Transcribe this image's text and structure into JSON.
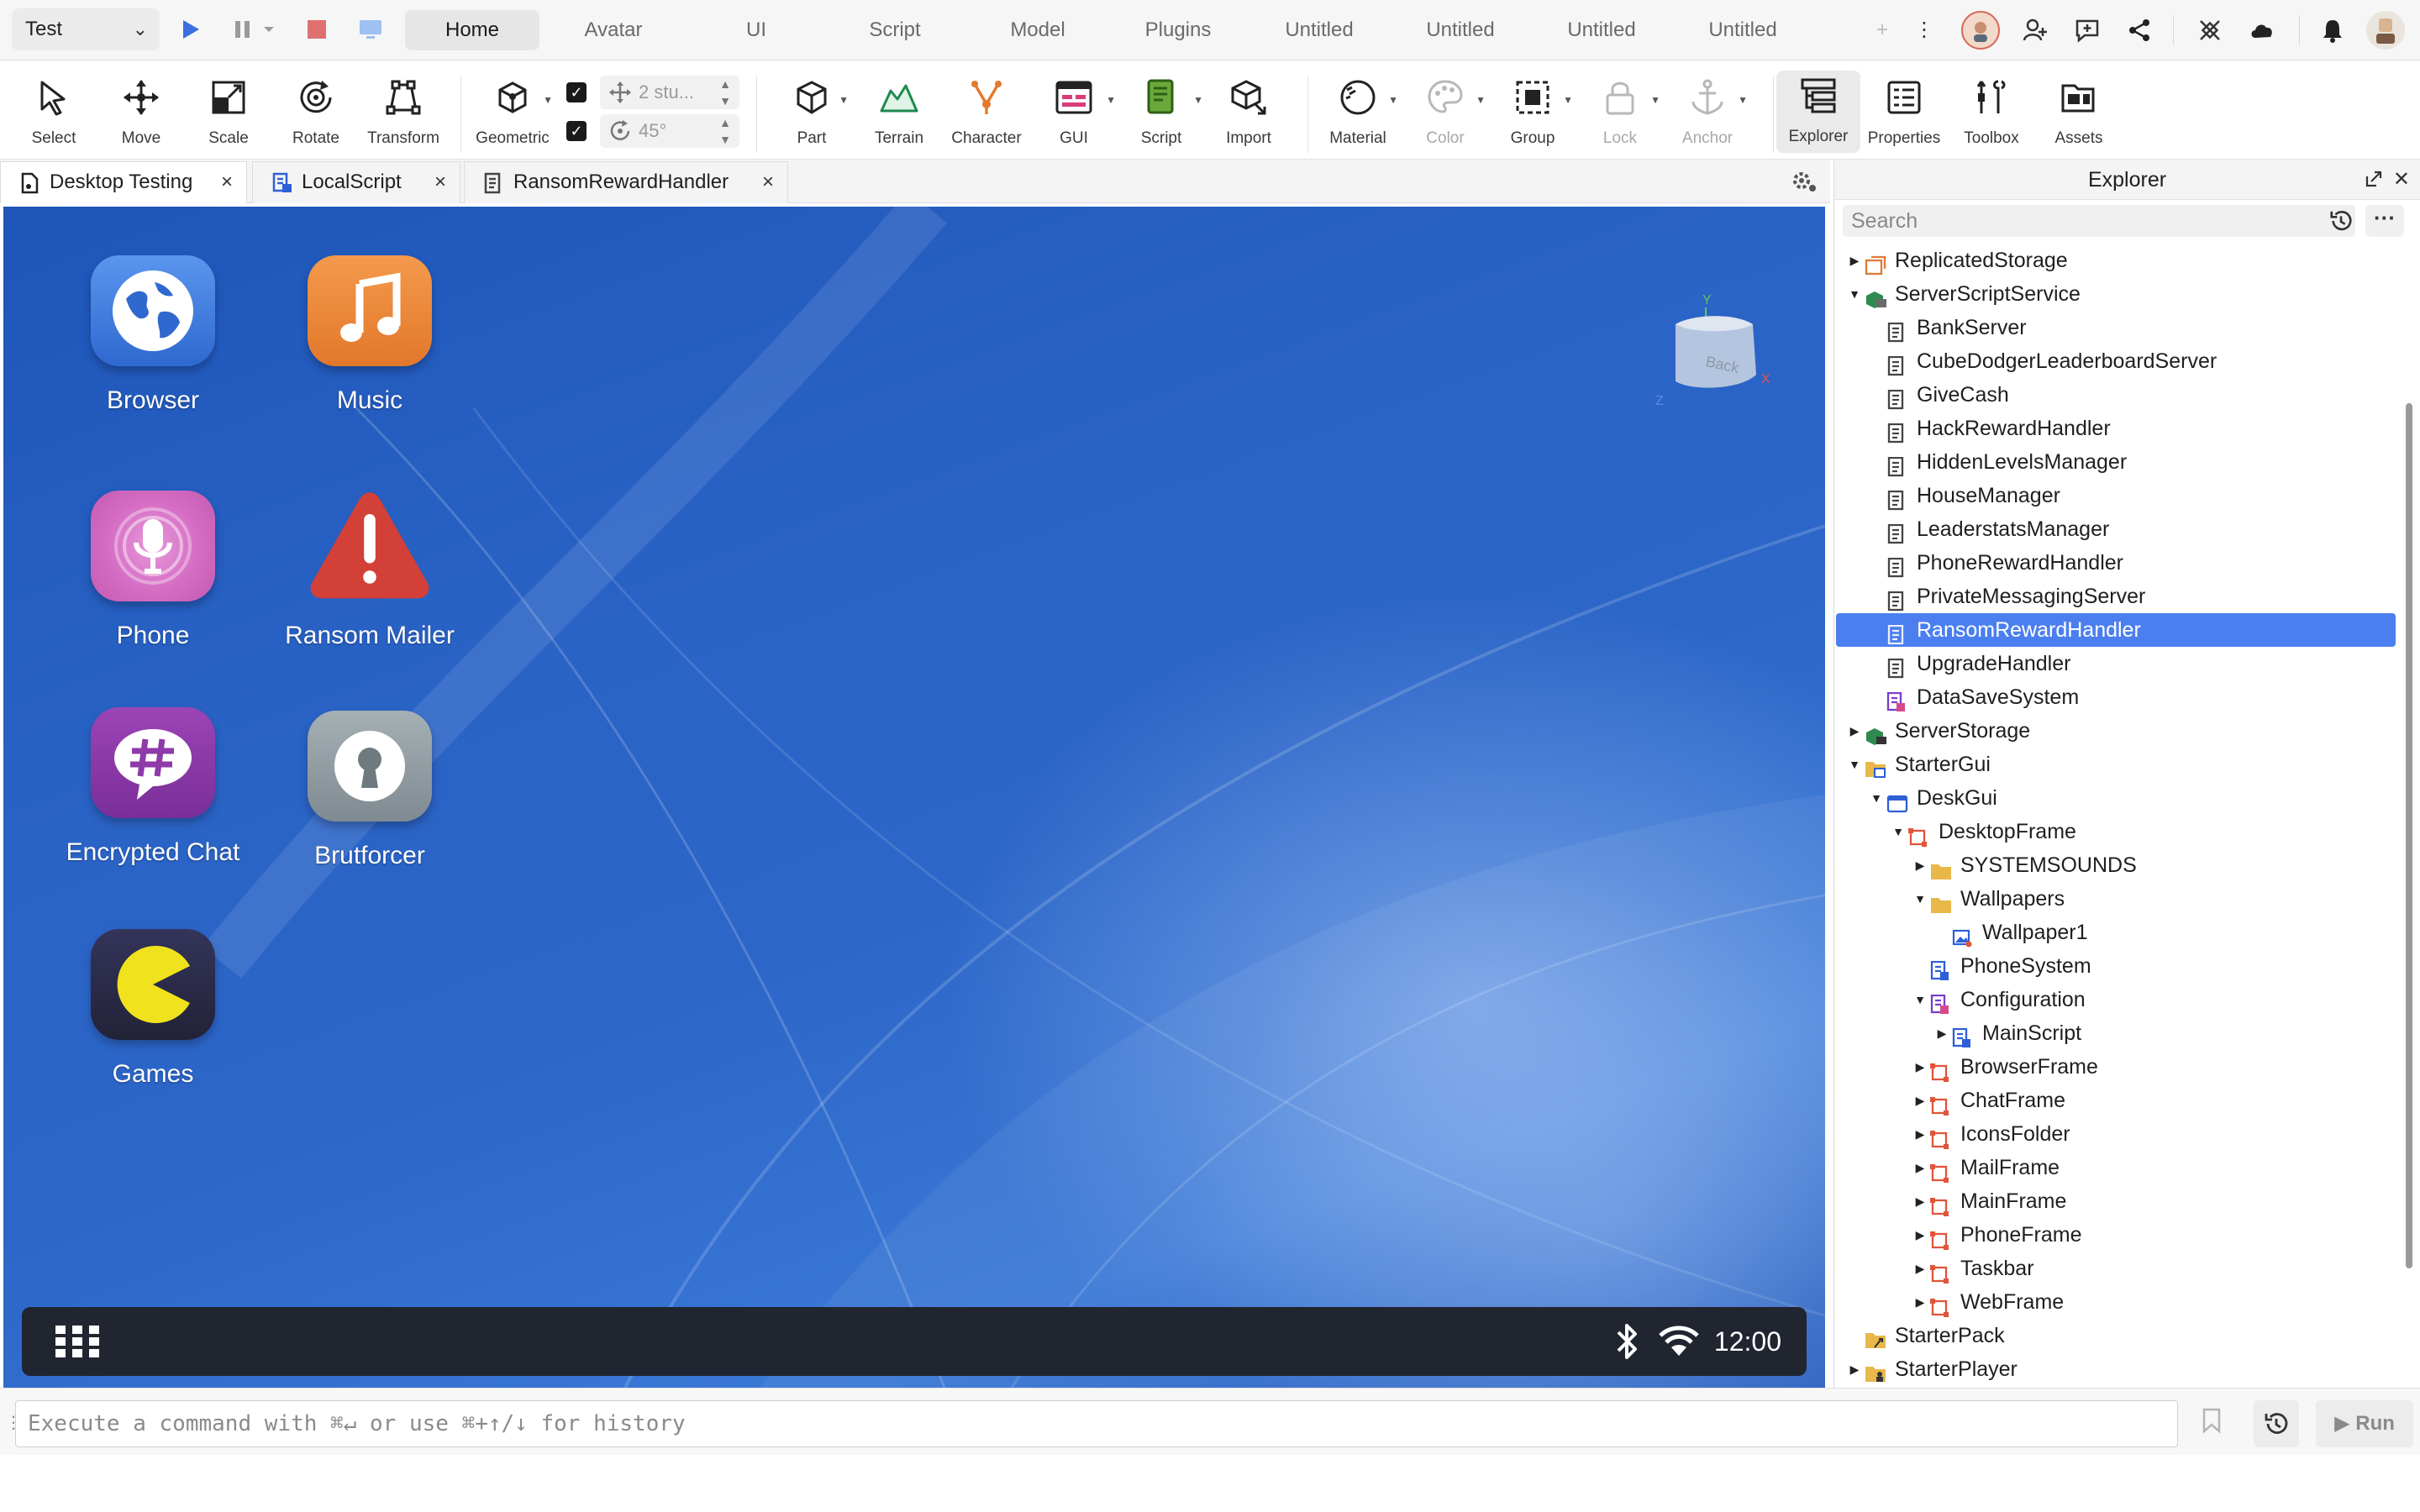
{
  "topbar": {
    "test_dropdown": "Test",
    "tabs": [
      "Home",
      "Avatar",
      "UI",
      "Script",
      "Model",
      "Plugins",
      "Untitled",
      "Untitled",
      "Untitled",
      "Untitled"
    ],
    "add_tab": "+",
    "more": "⋮"
  },
  "ribbon": {
    "tools": [
      "Select",
      "Move",
      "Scale",
      "Rotate",
      "Transform",
      "Geometric",
      "Part",
      "Terrain",
      "Character",
      "GUI",
      "Script",
      "Import",
      "Material",
      "Color",
      "Group",
      "Lock",
      "Anchor",
      "Explorer",
      "Properties",
      "Toolbox",
      "Assets"
    ],
    "move_snap": "2 stu...",
    "rotate_snap": "45°"
  },
  "doc_tabs": [
    {
      "label": "Desktop Testing"
    },
    {
      "label": "LocalScript"
    },
    {
      "label": "RansomRewardHandler"
    }
  ],
  "viewport": {
    "apps": [
      {
        "name": "Browser",
        "icon": "globe-icon",
        "color": "#3f7fe0"
      },
      {
        "name": "Music",
        "icon": "music-note-icon",
        "color": "#ee8a3a"
      },
      {
        "name": "Phone",
        "icon": "microphone-icon",
        "color": "#d56cc4"
      },
      {
        "name": "Ransom Mailer",
        "icon": "warning-icon",
        "color": "#d24038"
      },
      {
        "name": "Encrypted Chat",
        "icon": "hashtag-chat-icon",
        "color": "#8e3aa8"
      },
      {
        "name": "Brutforcer",
        "icon": "keyhole-icon",
        "color": "#8a969c"
      },
      {
        "name": "Games",
        "icon": "pacman-icon",
        "color": "#2c2c48"
      }
    ],
    "view_cube_label": "Back",
    "axes": {
      "y": "Y",
      "x": "X",
      "z": "Z"
    },
    "taskbar": {
      "clock": "12:00"
    }
  },
  "command_bar": {
    "placeholder": "Execute a command with ⌘↵ or use ⌘+↑/↓ for history",
    "run_label": "Run"
  },
  "explorer": {
    "title": "Explorer",
    "search_placeholder": "Search",
    "tree": [
      {
        "label": "ReplicatedStorage",
        "icon": "replicated-storage-icon",
        "depth": 0,
        "arrow": "collapsed"
      },
      {
        "label": "ServerScriptService",
        "icon": "server-script-service-icon",
        "depth": 0,
        "arrow": "expanded"
      },
      {
        "label": "BankServer",
        "icon": "script-icon",
        "depth": 1,
        "arrow": ""
      },
      {
        "label": "CubeDodgerLeaderboardServer",
        "icon": "script-icon",
        "depth": 1,
        "arrow": ""
      },
      {
        "label": "GiveCash",
        "icon": "script-icon",
        "depth": 1,
        "arrow": ""
      },
      {
        "label": "HackRewardHandler",
        "icon": "script-icon",
        "depth": 1,
        "arrow": ""
      },
      {
        "label": "HiddenLevelsManager",
        "icon": "script-icon",
        "depth": 1,
        "arrow": ""
      },
      {
        "label": "HouseManager",
        "icon": "script-icon",
        "depth": 1,
        "arrow": ""
      },
      {
        "label": "LeaderstatsManager",
        "icon": "script-icon",
        "depth": 1,
        "arrow": ""
      },
      {
        "label": "PhoneRewardHandler",
        "icon": "script-icon",
        "depth": 1,
        "arrow": ""
      },
      {
        "label": "PrivateMessagingServer",
        "icon": "script-icon",
        "depth": 1,
        "arrow": ""
      },
      {
        "label": "RansomRewardHandler",
        "icon": "script-icon",
        "depth": 1,
        "arrow": "",
        "selected": true
      },
      {
        "label": "UpgradeHandler",
        "icon": "script-icon",
        "depth": 1,
        "arrow": ""
      },
      {
        "label": "DataSaveSystem",
        "icon": "module-script-icon",
        "depth": 1,
        "arrow": ""
      },
      {
        "label": "ServerStorage",
        "icon": "server-storage-icon",
        "depth": 0,
        "arrow": "collapsed"
      },
      {
        "label": "StarterGui",
        "icon": "starter-gui-icon",
        "depth": 0,
        "arrow": "expanded"
      },
      {
        "label": "DeskGui",
        "icon": "screen-gui-icon",
        "depth": 1,
        "arrow": "expanded"
      },
      {
        "label": "DesktopFrame",
        "icon": "frame-icon",
        "depth": 2,
        "arrow": "expanded"
      },
      {
        "label": "SYSTEMSOUNDS",
        "icon": "folder-icon",
        "depth": 3,
        "arrow": "collapsed"
      },
      {
        "label": "Wallpapers",
        "icon": "folder-icon",
        "depth": 3,
        "arrow": "expanded"
      },
      {
        "label": "Wallpaper1",
        "icon": "image-label-icon",
        "depth": 4,
        "arrow": ""
      },
      {
        "label": "PhoneSystem",
        "icon": "local-script-icon",
        "depth": 3,
        "arrow": ""
      },
      {
        "label": "Configuration",
        "icon": "module-script-icon",
        "depth": 3,
        "arrow": "expanded"
      },
      {
        "label": "MainScript",
        "icon": "local-script-icon",
        "depth": 4,
        "arrow": "collapsed"
      },
      {
        "label": "BrowserFrame",
        "icon": "frame-icon",
        "depth": 3,
        "arrow": "collapsed"
      },
      {
        "label": "ChatFrame",
        "icon": "frame-icon",
        "depth": 3,
        "arrow": "collapsed"
      },
      {
        "label": "IconsFolder",
        "icon": "frame-icon",
        "depth": 3,
        "arrow": "collapsed"
      },
      {
        "label": "MailFrame",
        "icon": "frame-icon",
        "depth": 3,
        "arrow": "collapsed"
      },
      {
        "label": "MainFrame",
        "icon": "frame-icon",
        "depth": 3,
        "arrow": "collapsed"
      },
      {
        "label": "PhoneFrame",
        "icon": "frame-icon",
        "depth": 3,
        "arrow": "collapsed"
      },
      {
        "label": "Taskbar",
        "icon": "frame-icon",
        "depth": 3,
        "arrow": "collapsed"
      },
      {
        "label": "WebFrame",
        "icon": "frame-icon",
        "depth": 3,
        "arrow": "collapsed"
      },
      {
        "label": "StarterPack",
        "icon": "starter-pack-icon",
        "depth": 0,
        "arrow": ""
      },
      {
        "label": "StarterPlayer",
        "icon": "starter-player-icon",
        "depth": 0,
        "arrow": "collapsed"
      }
    ]
  },
  "colors": {
    "accent": "#4b7ff0",
    "play": "#3b6fe0",
    "stop": "#e07070",
    "frame_icon": "#e0553a",
    "folder_icon": "#e8b84a"
  }
}
